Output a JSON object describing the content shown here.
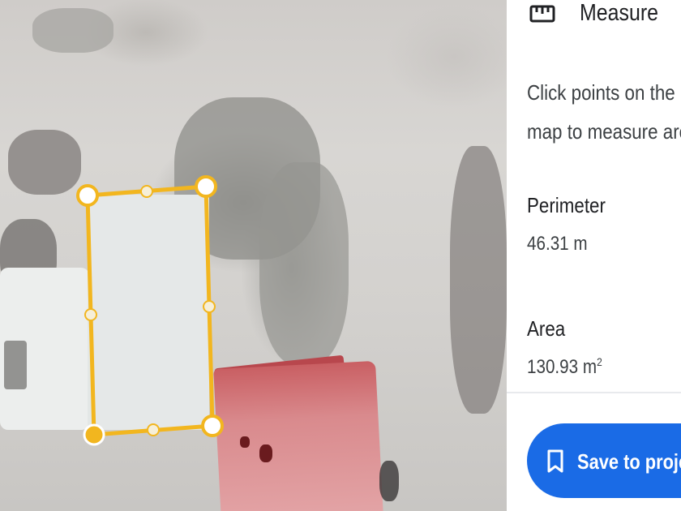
{
  "panel": {
    "title": "Measure",
    "title_icon": "ruler-icon",
    "instructions": "Click points on the map to measure area",
    "perimeter": {
      "label": "Perimeter",
      "value": "46.31 m"
    },
    "area": {
      "label": "Area",
      "value": "130.93 m",
      "unit_superscript": "2"
    },
    "save_button": {
      "label": "Save to project",
      "icon": "bookmark-icon"
    }
  },
  "colors": {
    "accent": "#1a6be6",
    "measure_line": "#f2b61f",
    "panel_bg": "#ffffff"
  }
}
